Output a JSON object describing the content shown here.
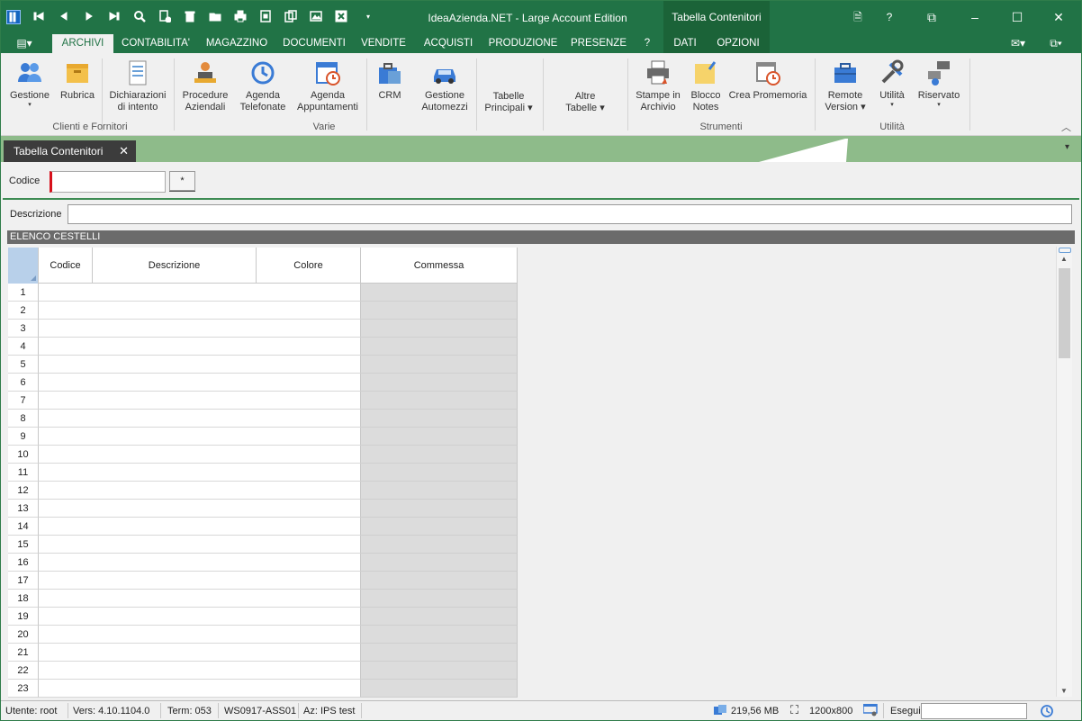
{
  "app": {
    "title": "IdeaAzienda.NET - Large Account Edition",
    "context_tab_title": "Tabella Contenitori",
    "accent": "#217346"
  },
  "window_controls": {
    "doc_label": "🗎",
    "help_label": "?",
    "restore_label": "⧉",
    "minimize_label": "–",
    "maximize_label": "☐",
    "close_label": "✕"
  },
  "quick_toolbar": [
    "app-logo-icon",
    "first-record-icon",
    "previous-record-icon",
    "next-record-icon",
    "last-record-icon",
    "search-icon",
    "new-record-icon",
    "delete-icon",
    "open-folder-icon",
    "print-icon",
    "export-icon",
    "copy-icon",
    "image-icon",
    "cancel-icon",
    "customize-dropdown-icon"
  ],
  "ribbon_tabs": [
    {
      "label": "ARCHIVI",
      "active": true
    },
    {
      "label": "CONTABILITA'"
    },
    {
      "label": "MAGAZZINO"
    },
    {
      "label": "DOCUMENTI"
    },
    {
      "label": "VENDITE"
    },
    {
      "label": "ACQUISTI"
    },
    {
      "label": "PRODUZIONE"
    },
    {
      "label": "PRESENZE"
    },
    {
      "label": "?"
    },
    {
      "label": "DATI"
    },
    {
      "label": "OPZIONI"
    }
  ],
  "ribbon": {
    "groups": [
      {
        "label": "Clienti e Fornitori"
      },
      {
        "label": "Varie"
      },
      {
        "label": "Strumenti"
      },
      {
        "label": "Utilità"
      }
    ],
    "buttons": [
      {
        "line1": "Gestione",
        "line2": "",
        "dropdown": "▾"
      },
      {
        "line1": "Rubrica",
        "line2": ""
      },
      {
        "line1": "Dichiarazioni",
        "line2": "di intento"
      },
      {
        "line1": "Procedure",
        "line2": "Aziendali"
      },
      {
        "line1": "Agenda",
        "line2": "Telefonate"
      },
      {
        "line1": "Agenda",
        "line2": "Appuntamenti"
      },
      {
        "line1": "CRM",
        "line2": ""
      },
      {
        "line1": "Gestione",
        "line2": "Automezzi"
      },
      {
        "line1": "Tabelle",
        "line2": "Principali ▾"
      },
      {
        "line1": "Altre",
        "line2": "Tabelle ▾"
      },
      {
        "line1": "Stampe in",
        "line2": "Archivio"
      },
      {
        "line1": "Blocco",
        "line2": "Notes"
      },
      {
        "line1": "Crea Promemoria",
        "line2": ""
      },
      {
        "line1": "Remote",
        "line2": "Version ▾"
      },
      {
        "line1": "Utilità",
        "line2": "",
        "dropdown": "▾"
      },
      {
        "line1": "Riservato",
        "line2": "",
        "dropdown": "▾"
      }
    ],
    "collapse_label": "︿"
  },
  "doc_tab": {
    "label": "Tabella Contenitori",
    "close": "✕",
    "menu": "▾"
  },
  "form": {
    "codice_label": "Codice",
    "codice_value": "",
    "star_button": "*",
    "descrizione_label": "Descrizione",
    "descrizione_value": "",
    "section_title": "ELENCO CESTELLI"
  },
  "grid": {
    "columns": [
      "Codice",
      "Descrizione",
      "Colore",
      "Commessa"
    ],
    "rows": [
      "1",
      "2",
      "3",
      "4",
      "5",
      "6",
      "7",
      "8",
      "9",
      "10",
      "11",
      "12",
      "13",
      "14",
      "15",
      "16",
      "17",
      "18",
      "19",
      "20",
      "21",
      "22",
      "23"
    ]
  },
  "status": {
    "utente": "Utente: root",
    "versione": "Vers: 4.10.1104.0",
    "term": "Term: 053",
    "ws": "WS0917-ASS01",
    "azienda": "Az: IPS test",
    "memory": "219,56 MB",
    "resolution": "1200x800",
    "esegui_label": "Esegui",
    "esegui_value": ""
  }
}
